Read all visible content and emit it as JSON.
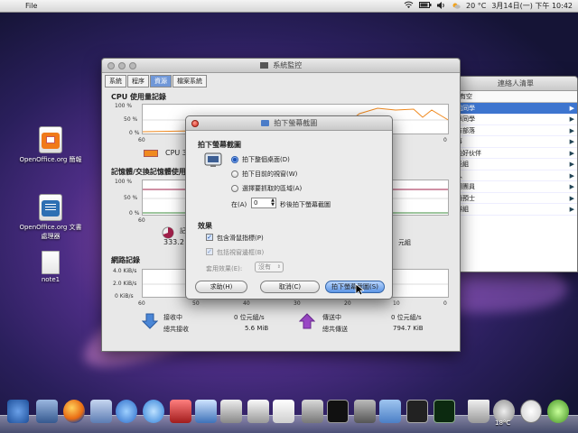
{
  "menubar": {
    "apple": "",
    "file": "File",
    "temp": "20 °C",
    "date": "3月14日(一) 下午 10:42"
  },
  "desktop": {
    "icons": [
      {
        "label": "OpenOffice.org 簡報"
      },
      {
        "label": "OpenOffice.org 文書處理器"
      },
      {
        "label": "note1"
      }
    ]
  },
  "sysmon": {
    "title": "系統監控",
    "tabs": [
      "系統",
      "程序",
      "資源",
      "檔案系統"
    ],
    "cpu_title": "CPU 使用量記錄",
    "cpu_yticks": [
      "100 %",
      "50 %",
      "0 %"
    ],
    "cpu_legend": "CPU 3",
    "mem_title": "記憶體/交換記憶體使用量",
    "mem_yticks": [
      "100 %",
      "50 %",
      "0 %"
    ],
    "mem_label": "記憶體",
    "mem_value": "333.2",
    "mem_right": "元組",
    "net_title": "網路記錄",
    "net_yticks": [
      "4.0 KiB/s",
      "2.0 KiB/s",
      "0 KiB/s"
    ],
    "xticks": [
      "60",
      "50",
      "40",
      "30",
      "20",
      "10",
      "0"
    ],
    "recv_label": "接收中",
    "recv_rate": "0 位元組/s",
    "recv_total_label": "總共接收",
    "recv_total": "5.6 MiB",
    "send_label": "傳送中",
    "send_rate": "0 位元組/s",
    "send_total_label": "總共傳送",
    "send_total": "794.7 KiB",
    "colors": {
      "cpu": "#f08a20",
      "mem": "#a0204a",
      "swap": "#3c8c3c"
    }
  },
  "contacts": {
    "title": "連絡人清單",
    "status": "有空",
    "items": [
      "我同學",
      "專同學",
      "方部落",
      "事",
      "晚好伙伴",
      "長組",
      "人",
      "團團員",
      "通預士",
      "群組"
    ]
  },
  "dialog": {
    "title": "拍下螢幕截圖",
    "heading": "拍下螢幕截圖",
    "options": [
      "拍下整個桌面(D)",
      "拍下目前的視窗(W)",
      "選擇要抓取的區域(A)"
    ],
    "selected_index": 0,
    "delay_prefix": "在(A)",
    "delay_value": "0",
    "delay_suffix": "秒後拍下螢幕截圖",
    "effects_heading": "效果",
    "include_pointer": "包含滑鼠指標(P)",
    "include_border": "包括視窗邊框(B)",
    "apply_effect_label": "套用效果(E):",
    "apply_effect_value": "沒有",
    "help_btn": "求助(H)",
    "cancel_btn": "取消(C)",
    "ok_btn": "拍下螢幕截圖(S)"
  },
  "dock": {
    "temp": "18°C"
  }
}
